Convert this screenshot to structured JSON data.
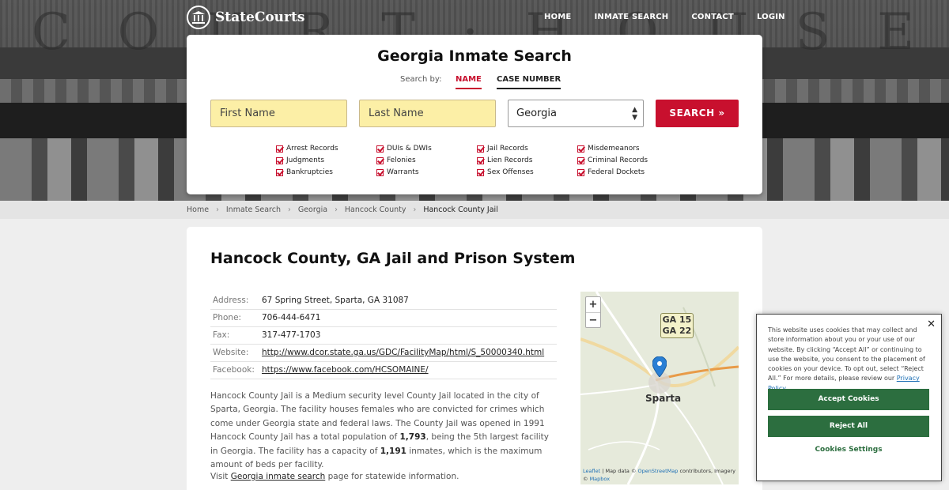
{
  "brand": {
    "name": "StateCourts"
  },
  "hero_letters": [
    "C",
    "O",
    "U",
    "R",
    "T",
    "·",
    "H",
    "O",
    "U",
    "S",
    "E"
  ],
  "nav": {
    "items": [
      "HOME",
      "INMATE SEARCH",
      "CONTACT",
      "LOGIN"
    ]
  },
  "search": {
    "title": "Georgia Inmate Search",
    "search_by": "Search by:",
    "tab_name": "NAME",
    "tab_case": "CASE NUMBER",
    "first_placeholder": "First Name",
    "last_placeholder": "Last Name",
    "state": "Georgia",
    "button": "SEARCH »",
    "record_types": [
      "Arrest Records",
      "DUIs & DWIs",
      "Jail Records",
      "Misdemeanors",
      "Judgments",
      "Felonies",
      "Lien Records",
      "Criminal Records",
      "Bankruptcies",
      "Warrants",
      "Sex Offenses",
      "Federal Dockets"
    ]
  },
  "breadcrumb": [
    "Home",
    "Inmate Search",
    "Georgia",
    "Hancock County",
    "Hancock County Jail"
  ],
  "facility": {
    "title": "Hancock County, GA Jail and Prison System",
    "rows": [
      {
        "key": "Address:",
        "value": "67 Spring Street, Sparta, GA 31087"
      },
      {
        "key": "Phone:",
        "value": "706-444-6471"
      },
      {
        "key": "Fax:",
        "value": "317-477-1703"
      },
      {
        "key": "Website:",
        "value": "http://www.dcor.state.ga.us/GDC/FacilityMap/html/S_50000340.html"
      },
      {
        "key": "Facebook:",
        "value": "https://www.facebook.com/HCSOMAINE/"
      }
    ],
    "desc_1": "Hancock County Jail is a Medium security level County Jail located in the city of Sparta, Georgia. The facility houses females who are convicted for crimes which come under Georgia state and federal laws. The County Jail was opened in 1991 Hancock County Jail has a total population of ",
    "population": "1,793",
    "desc_2": ", being the 5th largest facility in Georgia. The facility has a capacity of ",
    "capacity": "1,191",
    "desc_3": " inmates, which is the maximum amount of beds per facility.",
    "visit_pre": "Visit ",
    "visit_link": "Georgia inmate search",
    "visit_post": " page for statewide information."
  },
  "map": {
    "zoom_in": "+",
    "zoom_out": "−",
    "shield_1": "GA 15",
    "shield_2": "GA 22",
    "town": "Sparta",
    "credit_leaflet": "Leaflet",
    "credit_mid": " | Map data © ",
    "credit_osm": "OpenStreetMap",
    "credit_end": " contributors, Imagery © ",
    "credit_mapbox": "Mapbox"
  },
  "cookie": {
    "text": "This website uses cookies that may collect and store information about you or your use of our website. By clicking “Accept All” or continuing to use the website, you consent to the placement of cookies on your device. To opt out, select “Reject All.” For more details, please review our ",
    "policy": "Privacy Policy",
    "accept": "Accept Cookies",
    "reject": "Reject All",
    "settings": "Cookies Settings",
    "close": "✕"
  },
  "colors": {
    "accent": "#c8102e",
    "cookie_green": "#2c6e3f",
    "input_bg": "#fcefa6"
  }
}
